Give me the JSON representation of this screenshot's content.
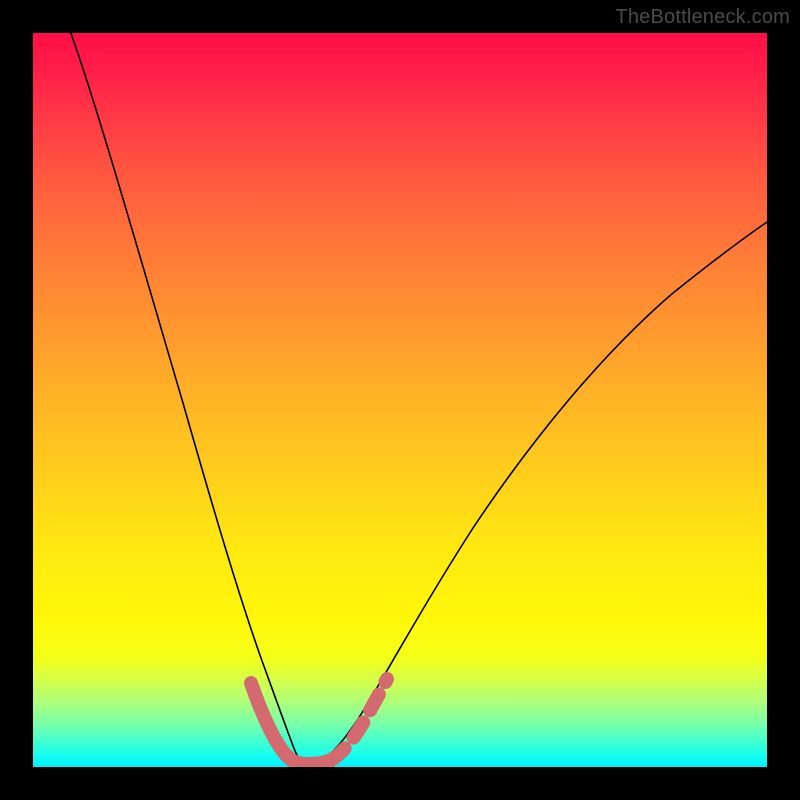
{
  "watermark": "TheBottleneck.com",
  "chart_data": {
    "type": "line",
    "title": "",
    "xlabel": "",
    "ylabel": "",
    "xlim": [
      0,
      100
    ],
    "ylim": [
      0,
      100
    ],
    "grid": false,
    "legend": false,
    "gradient": {
      "top_color": "#ff0e47",
      "bottom_color": "#00f0ff",
      "meaning": "red-high-to-green-low bottleneck scale"
    },
    "series": [
      {
        "name": "bottleneck-curve",
        "stroke": "#000000",
        "x": [
          5,
          10,
          15,
          20,
          24,
          28,
          30,
          32,
          34,
          35,
          36,
          38,
          40,
          42,
          45,
          50,
          55,
          60,
          65,
          70,
          75,
          80,
          85,
          90,
          95,
          100
        ],
        "y": [
          100,
          82,
          64,
          46,
          31,
          18,
          12,
          6,
          2,
          0.5,
          0.5,
          1,
          2,
          4,
          8,
          16,
          24,
          32,
          39,
          46,
          52,
          57,
          62,
          66,
          69,
          72
        ]
      },
      {
        "name": "optimal-range-highlight",
        "stroke": "#d26a6f",
        "x": [
          29,
          31,
          33,
          35,
          37,
          39,
          41,
          43,
          46,
          48
        ],
        "y": [
          14,
          8,
          3,
          0.5,
          0.5,
          1,
          2,
          4,
          9,
          13
        ]
      }
    ],
    "annotations": []
  }
}
